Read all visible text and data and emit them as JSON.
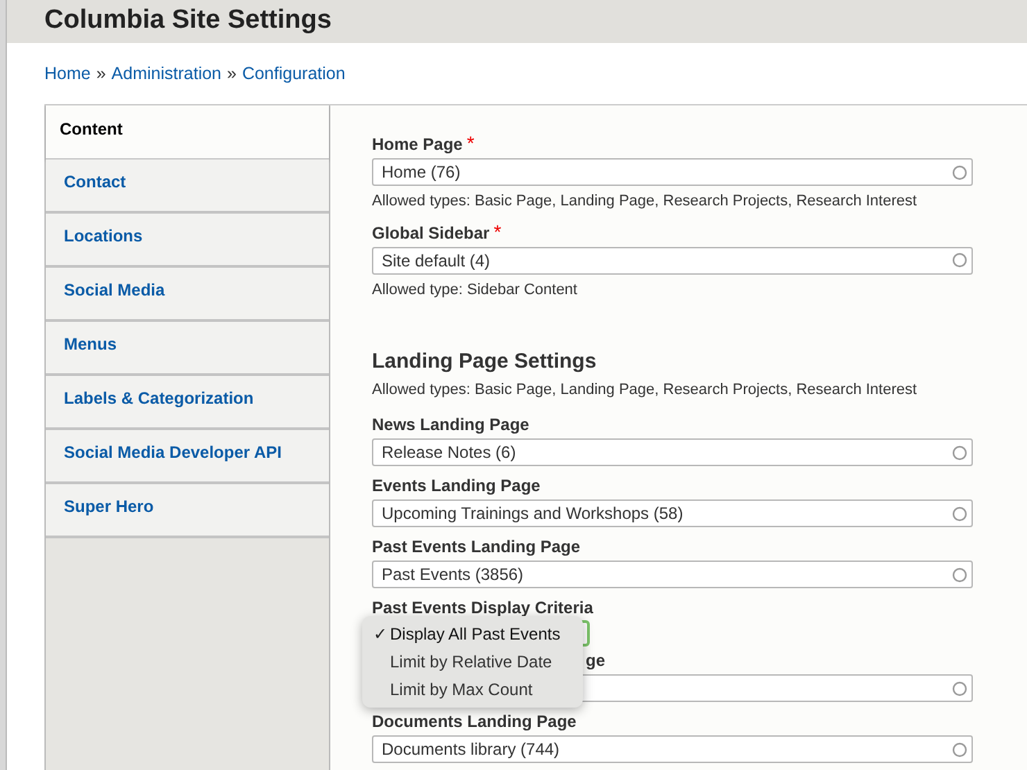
{
  "page_title": "Columbia Site Settings",
  "breadcrumb": [
    "Home",
    "Administration",
    "Configuration"
  ],
  "breadcrumb_separator": "»",
  "tabs": [
    {
      "label": "Content",
      "selected": true
    },
    {
      "label": "Contact",
      "selected": false
    },
    {
      "label": "Locations",
      "selected": false
    },
    {
      "label": "Social Media",
      "selected": false
    },
    {
      "label": "Menus",
      "selected": false
    },
    {
      "label": "Labels & Categorization",
      "selected": false
    },
    {
      "label": "Social Media Developer API",
      "selected": false
    },
    {
      "label": "Super Hero",
      "selected": false
    }
  ],
  "items": [
    {
      "kind": "field",
      "label": "Home Page",
      "required_mark": "*",
      "value": "Home (76)",
      "help": "Allowed types: Basic Page, Landing Page, Research Projects, Research Interest"
    },
    {
      "kind": "field",
      "label": "Global Sidebar",
      "required_mark": "*",
      "value": "Site default (4)",
      "help": "Allowed type: Sidebar Content"
    },
    {
      "kind": "section",
      "title": "Landing Page Settings",
      "help": "Allowed types: Basic Page, Landing Page, Research Projects, Research Interest"
    },
    {
      "kind": "field",
      "label": "News Landing Page",
      "value": "Release Notes (6)"
    },
    {
      "kind": "field",
      "label": "Events Landing Page",
      "value": "Upcoming Trainings and Workshops (58)"
    },
    {
      "kind": "field",
      "label": "Past Events Landing Page",
      "value": "Past Events (3856)"
    },
    {
      "kind": "select",
      "label": "Past Events Display Criteria",
      "options": [
        {
          "label": "Display All Past Events",
          "selected": true
        },
        {
          "label": "Limit by Relative Date",
          "selected": false
        },
        {
          "label": "Limit by Max Count",
          "selected": false
        }
      ],
      "check": "✓"
    },
    {
      "kind": "covered_field",
      "label": "ge"
    },
    {
      "kind": "field",
      "label": "Documents Landing Page",
      "value": "Documents library (744)"
    }
  ]
}
